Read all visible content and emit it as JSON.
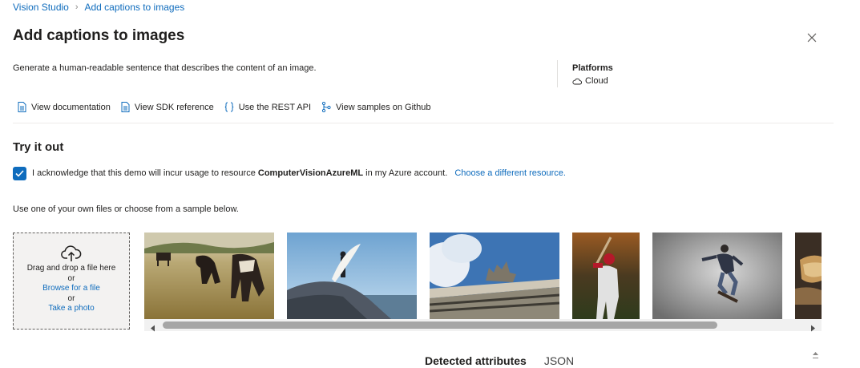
{
  "breadcrumb": {
    "root": "Vision Studio",
    "current": "Add captions to images"
  },
  "page": {
    "title": "Add captions to images",
    "description": "Generate a human-readable sentence that describes the content of an image."
  },
  "platforms": {
    "label": "Platforms",
    "value": "Cloud"
  },
  "links": [
    {
      "label": "View documentation",
      "icon": "document-icon"
    },
    {
      "label": "View SDK reference",
      "icon": "document-icon"
    },
    {
      "label": "Use the REST API",
      "icon": "braces-icon"
    },
    {
      "label": "View samples on Github",
      "icon": "branch-icon"
    }
  ],
  "try_it": {
    "title": "Try it out",
    "ack_prefix": "I acknowledge that this demo will incur usage to resource",
    "resource": "ComputerVisionAzureML",
    "ack_suffix": "in my Azure account.",
    "choose_link": "Choose a different resource.",
    "checked": true,
    "use_text": "Use one of your own files or choose from a sample below."
  },
  "dropzone": {
    "line1": "Drag and drop a file here",
    "or1": "or",
    "browse": "Browse for a file",
    "or2": "or",
    "photo": "Take a photo"
  },
  "samples": [
    {
      "name": "sample-image-horses-in-field"
    },
    {
      "name": "sample-image-surfer-on-rocks"
    },
    {
      "name": "sample-image-building-statue"
    },
    {
      "name": "sample-image-baseball-batter"
    },
    {
      "name": "sample-image-skateboarder"
    },
    {
      "name": "sample-image-bread-partial"
    }
  ],
  "tabs": {
    "detected": "Detected attributes",
    "json": "JSON"
  },
  "colors": {
    "accent": "#0f6cbd",
    "dropzone_bg": "#f3f2f1"
  }
}
